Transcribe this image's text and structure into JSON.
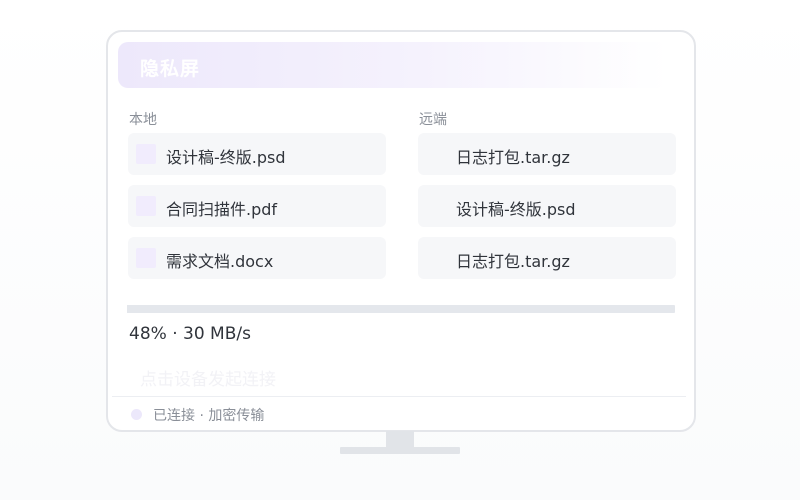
{
  "window": {
    "title": "隐私屏"
  },
  "local": {
    "label": "本地",
    "files": [
      "设计稿-终版.psd",
      "合同扫描件.pdf",
      "需求文档.docx"
    ]
  },
  "remote": {
    "label": "远端",
    "files": [
      "日志打包.tar.gz",
      "设计稿-终版.psd",
      "日志打包.tar.gz"
    ]
  },
  "transfer": {
    "progress_percent": 48,
    "speed_text": "48% · 30 MB/s",
    "hint": "点击设备发起连接"
  },
  "status": {
    "text": "已连接 · 加密传输"
  },
  "colors": {
    "accent_light": "#ede8fb",
    "file_bg": "#f6f7f9",
    "text": "#30343b",
    "muted": "#8a8f98"
  }
}
